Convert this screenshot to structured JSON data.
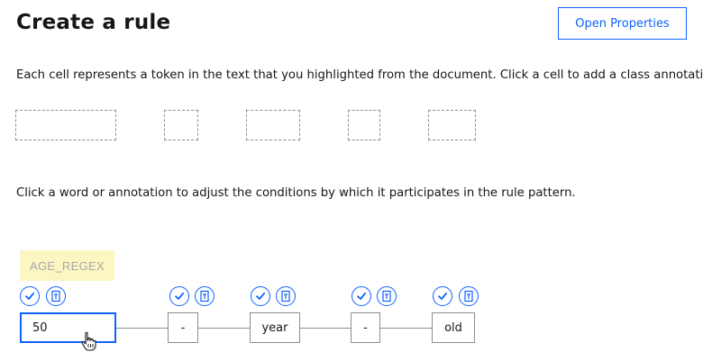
{
  "header": {
    "title": "Create a rule",
    "open_properties_label": "Open Properties"
  },
  "instructions": {
    "cells_text": "Each cell represents a token in the text that you highlighted from the document. Click a cell to add a class annotation.",
    "conditions_text": "Click a word or annotation to adjust the conditions by which it participates in the rule pattern."
  },
  "annotation": {
    "label": "AGE_REGEX"
  },
  "tokens": [
    "50",
    "-",
    "year",
    "-",
    "old"
  ],
  "icons": {
    "check": "checkmark-icon",
    "text": "text-token-icon"
  },
  "colors": {
    "accent": "#0f62fe",
    "annotation_bg": "#fcf6c3",
    "border": "#8d8d8d"
  }
}
